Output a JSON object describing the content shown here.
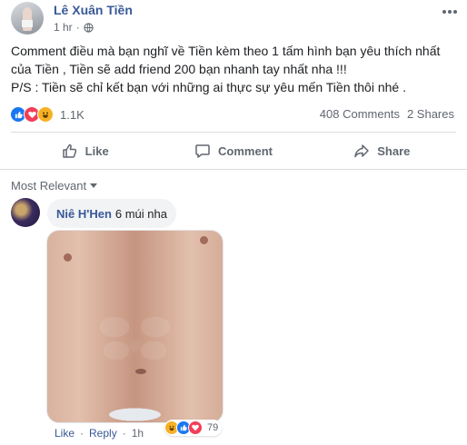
{
  "post": {
    "author": "Lê Xuân Tiền",
    "time": "1 hr",
    "dot": "·",
    "audience_icon": "globe-icon",
    "more_icon": "more-horizontal-icon",
    "text_line1": "Comment điều mà bạn nghĩ về Tiền kèm theo 1 tấm hình bạn yêu thích nhất",
    "text_line2": "của Tiền , Tiền sẽ add friend 200 bạn nhanh tay nhất nha !!!",
    "text_line3": "P/S : Tiền sẽ chỉ kết bạn với những ai thực sự yêu mến Tiền thôi nhé ."
  },
  "reactions": {
    "icons": [
      "like-reaction-icon",
      "love-reaction-icon",
      "haha-reaction-icon"
    ],
    "count": "1.1K",
    "comments": "408 Comments",
    "shares": "2 Shares"
  },
  "actions": {
    "like": "Like",
    "comment": "Comment",
    "share": "Share"
  },
  "comments": {
    "sort_label": "Most Relevant",
    "items": [
      {
        "name": "Niê H'Hen",
        "text": "6 múi nha",
        "like_label": "Like",
        "reply_label": "Reply",
        "dot": "·",
        "time": "1h",
        "reaction_count": "79"
      }
    ]
  },
  "colors": {
    "link": "#385898",
    "secondary_text": "#606770",
    "like_blue": "#1877f2",
    "love_red": "#f33e58",
    "haha_yellow": "#f7b125",
    "bubble_bg": "#f2f3f5"
  }
}
